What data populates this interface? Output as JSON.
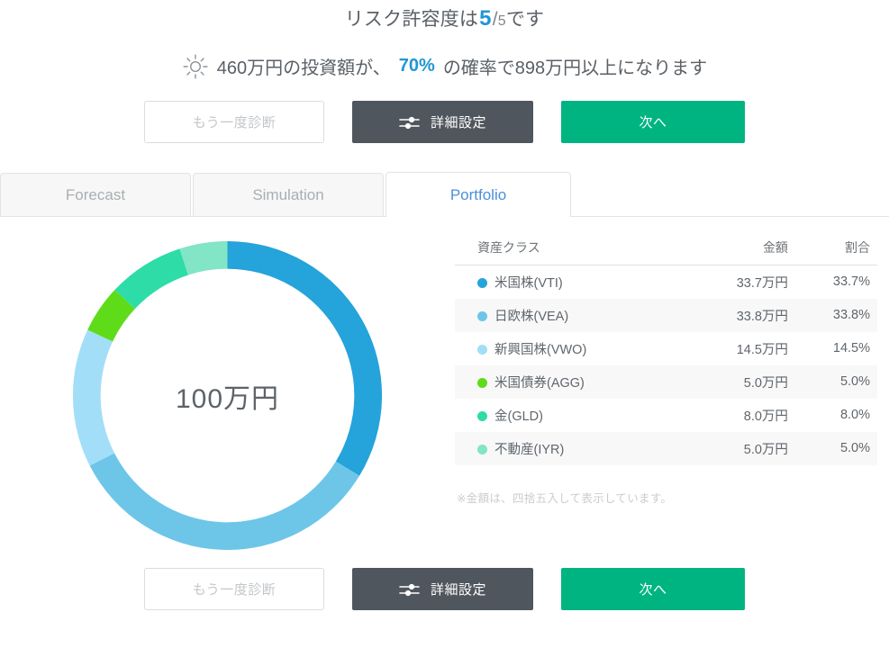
{
  "header": {
    "risk_prefix": "リスク許容度は",
    "risk_score": "5",
    "risk_sep": "/",
    "risk_total": "5",
    "risk_suffix": "です",
    "forecast_part1": "460万円の投資額が、",
    "forecast_probability": "70%",
    "forecast_part2": "の確率で898万円以上になります",
    "sun_icon": "sun-icon"
  },
  "actions": {
    "rediagnose_label": "もう一度診断",
    "detail_settings_label": "詳細設定",
    "detail_settings_icon": "sliders-icon",
    "next_label": "次へ"
  },
  "tabs": [
    {
      "label": "Forecast",
      "active": false
    },
    {
      "label": "Simulation",
      "active": false
    },
    {
      "label": "Portfolio",
      "active": true
    }
  ],
  "donut": {
    "center_label": "100万円"
  },
  "table": {
    "columns": [
      "資産クラス",
      "金額",
      "割合"
    ],
    "footnote": "※金額は、四捨五入して表示しています。",
    "rows": [
      {
        "name": "米国株(VTI)",
        "amount": "33.7万円",
        "percent": "33.7%",
        "color": "#25a3db"
      },
      {
        "name": "日欧株(VEA)",
        "amount": "33.8万円",
        "percent": "33.8%",
        "color": "#6dc6e8"
      },
      {
        "name": "新興国株(VWO)",
        "amount": "14.5万円",
        "percent": "14.5%",
        "color": "#a2def8"
      },
      {
        "name": "米国債券(AGG)",
        "amount": "5.0万円",
        "percent": "5.0%",
        "color": "#5edc19"
      },
      {
        "name": "金(GLD)",
        "amount": "8.0万円",
        "percent": "8.0%",
        "color": "#2edca8"
      },
      {
        "name": "不動産(IYR)",
        "amount": "5.0万円",
        "percent": "5.0%",
        "color": "#82e5c5"
      }
    ]
  },
  "chart_data": {
    "type": "pie",
    "title": "Portfolio",
    "center_label": "100万円",
    "donut": true,
    "inner_radius_ratio": 0.82,
    "start_angle_deg": 0,
    "legend_position": "right",
    "labels": [
      "米国株(VTI)",
      "日欧株(VEA)",
      "新興国株(VWO)",
      "米国債券(AGG)",
      "金(GLD)",
      "不動産(IYR)"
    ],
    "values": [
      33.7,
      33.8,
      14.5,
      5.0,
      8.0,
      5.0
    ],
    "amounts_man_yen": [
      33.7,
      33.8,
      14.5,
      5.0,
      8.0,
      5.0
    ],
    "unit": "%",
    "colors": [
      "#25a3db",
      "#6dc6e8",
      "#a2def8",
      "#5edc19",
      "#2edca8",
      "#82e5c5"
    ],
    "total_amount": "100万円"
  }
}
